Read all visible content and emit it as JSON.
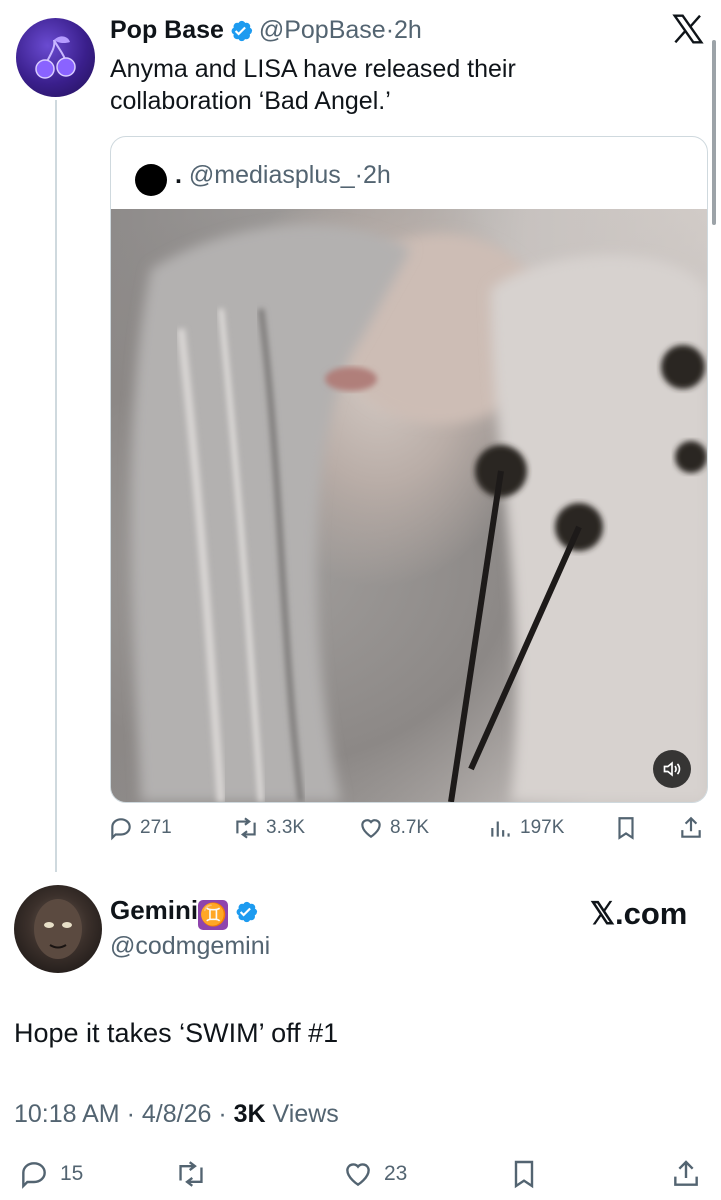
{
  "tweet": {
    "name": "Pop Base",
    "handle": "@PopBase",
    "sep": "·",
    "time": "2h",
    "text": "Anyma and LISA have released their collaboration ‘Bad Angel.’",
    "close_icon": "x-logo-icon",
    "quote": {
      "name": ".",
      "handle": "@mediasplus_",
      "sep": "·",
      "time": "2h"
    },
    "stats": {
      "replies": "271",
      "reposts": "3.3K",
      "likes": "8.7K",
      "views": "197K"
    }
  },
  "reply": {
    "name": "Gemini",
    "emoji": "♊",
    "handle": "@codmgemini",
    "brand": "𝕏.com",
    "text": "Hope it takes ‘SWIM’ off #1",
    "time": "10:18 AM",
    "date": "4/8/26",
    "views_count": "3K",
    "views_label": "Views",
    "stats": {
      "replies": "15",
      "likes": "23"
    }
  },
  "colors": {
    "text": "#0f1419",
    "muted": "#536471",
    "verified": "#1d9bf0",
    "border": "#cfd9de"
  }
}
